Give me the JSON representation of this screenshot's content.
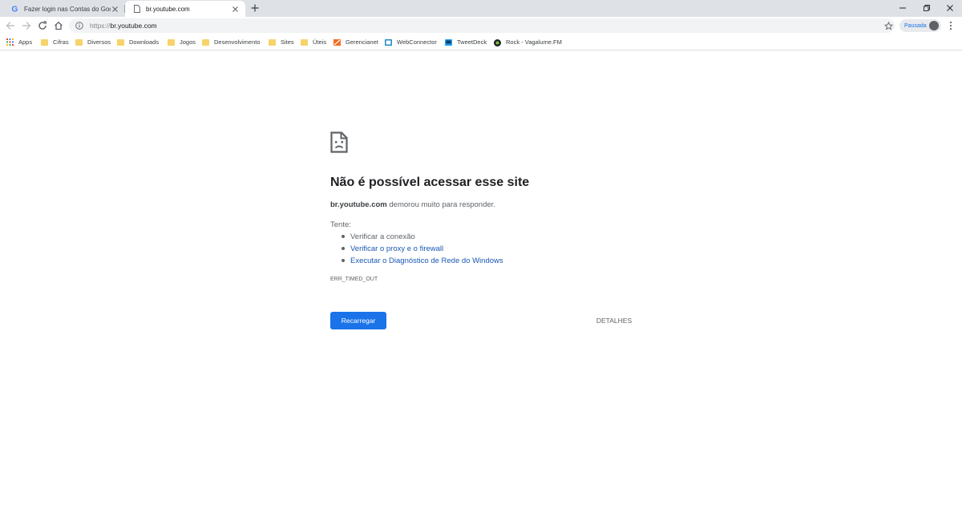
{
  "tabs": [
    {
      "title": "Fazer login nas Contas do Google",
      "icon": "google-icon"
    },
    {
      "title": "br.youtube.com",
      "icon": "page-icon",
      "active": true
    }
  ],
  "toolbar": {
    "url_scheme": "https://",
    "url_host": "br.youtube.com",
    "profile_label": "Pausada"
  },
  "bookmarks": [
    {
      "label": "Apps",
      "icon": "apps-grid-icon"
    },
    {
      "label": "Cifras",
      "icon": "folder-icon"
    },
    {
      "label": "Diversos",
      "icon": "folder-icon"
    },
    {
      "label": "Downloads",
      "icon": "folder-icon"
    },
    {
      "label": "Jogos",
      "icon": "folder-icon"
    },
    {
      "label": "Desenvolvimento",
      "icon": "folder-icon"
    },
    {
      "label": "Sites",
      "icon": "folder-icon"
    },
    {
      "label": "Úteis",
      "icon": "folder-icon"
    },
    {
      "label": "Gerencianet",
      "icon": "gerencianet-icon"
    },
    {
      "label": "WebConnector",
      "icon": "webconnector-icon"
    },
    {
      "label": "TweetDeck",
      "icon": "tweetdeck-icon"
    },
    {
      "label": "Rock - Vagalume.FM",
      "icon": "vagalume-icon"
    }
  ],
  "error": {
    "title": "Não é possível acessar esse site",
    "host": "br.youtube.com",
    "description": " demorou muito para responder.",
    "try_label": "Tente:",
    "suggestions": [
      "Verificar a conexão",
      "Verificar o proxy e o firewall",
      "Executar o Diagnóstico de Rede do Windows"
    ],
    "code": "ERR_TIMED_OUT",
    "reload_label": "Recarregar",
    "details_label": "DETALHES"
  },
  "colors": {
    "accent": "#1a73e8",
    "link": "#1a58b3",
    "tabstrip": "#dee1e6"
  }
}
